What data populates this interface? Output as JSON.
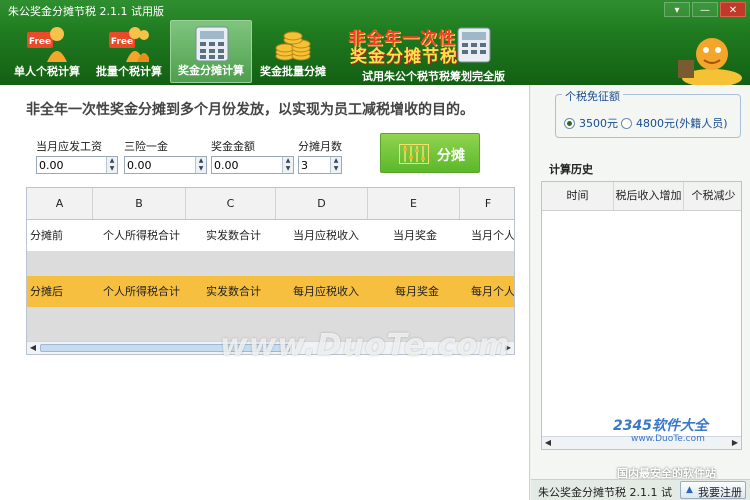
{
  "window": {
    "title": "朱公奖金分摊节税 2.1.1 试用版",
    "controls": [
      "▾",
      "—",
      "✕"
    ]
  },
  "toolbar": {
    "buttons": [
      {
        "label": "单人个税计算",
        "icon": "free-person-icon",
        "badge": "Free"
      },
      {
        "label": "批量个税计算",
        "icon": "free-group-icon",
        "badge": "Free"
      },
      {
        "label": "奖金分摊计算",
        "icon": "calculator-icon",
        "active": true
      },
      {
        "label": "奖金批量分摊",
        "icon": "coins-icon"
      }
    ],
    "promo": {
      "line1": "非全年一次性",
      "line2": "奖金分摊节税",
      "label": "试用朱公个税节税筹划完全版"
    }
  },
  "main": {
    "description": "非全年一次性奖金分摊到多个月份发放，以实现为员工减税增收的目的。",
    "fields": {
      "salary": {
        "label": "当月应发工资",
        "value": "0.00"
      },
      "insurance": {
        "label": "三险一金",
        "value": "0.00"
      },
      "bonus": {
        "label": "奖金金额",
        "value": "0.00"
      },
      "months": {
        "label": "分摊月数",
        "value": "3"
      }
    },
    "split_button": "分摊",
    "grid": {
      "columns": [
        "A",
        "B",
        "C",
        "D",
        "E",
        "F"
      ],
      "rows": [
        [
          "分摊前",
          "个人所得税合计",
          "实发数合计",
          "当月应税收入",
          "当月奖金",
          "当月个人所"
        ],
        [
          "分摊后",
          "个人所得税合计",
          "实发数合计",
          "每月应税收入",
          "每月奖金",
          "每月个人所"
        ]
      ]
    },
    "watermark": "www.DuoTe.com"
  },
  "side": {
    "exempt_title": "个税免征额",
    "options": [
      {
        "label": "3500元",
        "selected": true
      },
      {
        "label": "4800元(外籍人员)",
        "selected": false
      }
    ],
    "history_title": "计算历史",
    "history_columns": [
      "时间",
      "税后收入增加",
      "个税减少"
    ],
    "watermark_brand": "2345软件大全",
    "watermark_url": "www.DuoTe.com",
    "watermark_slogan": "国内最安全的软件站"
  },
  "status": {
    "text": "朱公奖金分摊节税 2.1.1 试",
    "register_label": "我要注册"
  },
  "colors": {
    "header_green": "#1f7a1f",
    "split_button_green": "#5cb82a",
    "after_row_amber": "#f7bf3f",
    "promo_red": "#ff3a2a",
    "promo_yellow": "#ffe04a"
  }
}
